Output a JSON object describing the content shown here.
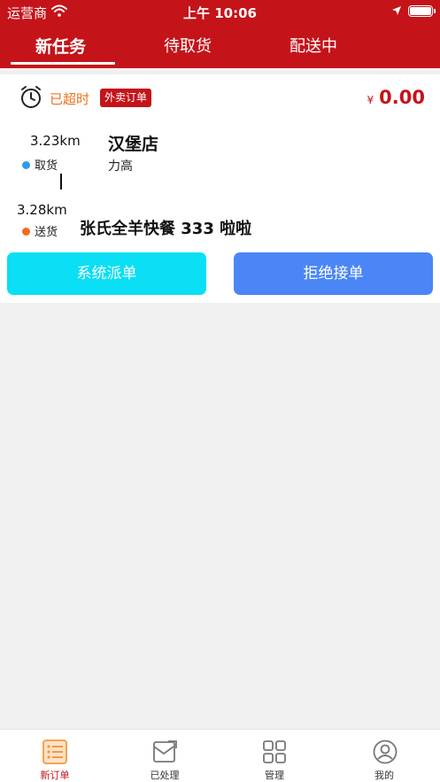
{
  "status_bar": {
    "carrier": "运营商",
    "time": "上午 10:06"
  },
  "tabs": [
    {
      "label": "新任务"
    },
    {
      "label": "待取货"
    },
    {
      "label": "配送中"
    }
  ],
  "order": {
    "status_text": "已超时",
    "badge": "外卖订单",
    "currency": "¥",
    "amount": "0.00",
    "pickup": {
      "distance": "3.23km",
      "label": "取货",
      "store": "汉堡店",
      "sub": "力高"
    },
    "delivery": {
      "distance": "3.28km",
      "label": "送货",
      "destination": "张氏全羊快餐 333 啦啦"
    },
    "dot_colors": {
      "pickup": "#2f9be8",
      "delivery": "#f46a1c"
    }
  },
  "actions": {
    "dispatch": "系统派单",
    "reject": "拒绝接单"
  },
  "bottom_nav": [
    {
      "label": "新订单",
      "icon": "order-list-icon"
    },
    {
      "label": "已处理",
      "icon": "processed-icon"
    },
    {
      "label": "管理",
      "icon": "grid-icon"
    },
    {
      "label": "我的",
      "icon": "user-icon"
    }
  ],
  "colors": {
    "brand": "#c4141a",
    "dispatch": "#0adff5",
    "reject": "#4b86f7"
  }
}
